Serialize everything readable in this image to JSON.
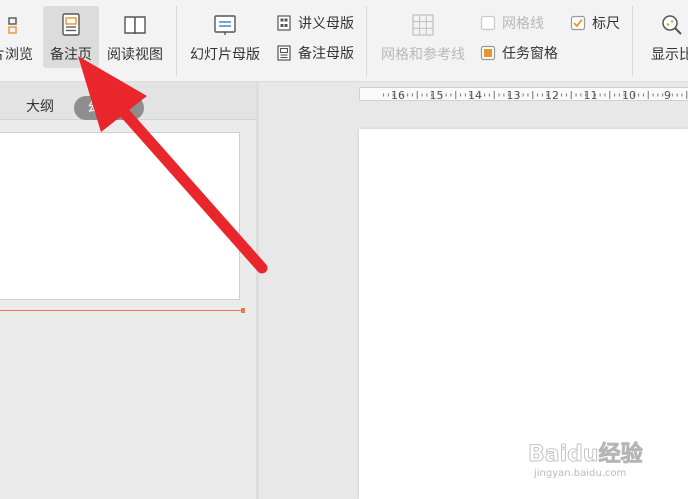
{
  "ribbon": {
    "browse_label": "片浏览",
    "notes_page_label": "备注页",
    "reading_view_label": "阅读视图",
    "slide_master_label": "幻灯片母版",
    "handout_master_label": "讲义母版",
    "notes_master_label": "备注母版",
    "grid_guides_label": "网格和参考线",
    "gridlines_label": "网格线",
    "ruler_label": "标尺",
    "task_pane_label": "任务窗格",
    "zoom_label": "显示比",
    "gridlines_checked": false,
    "ruler_checked": true,
    "task_pane_checked": true
  },
  "left_pane": {
    "tabs": [
      {
        "label": "大纲",
        "active": false
      },
      {
        "label": "幻灯片",
        "active": true
      }
    ]
  },
  "ruler": {
    "numbers": [
      "16",
      "15",
      "14",
      "13",
      "12",
      "11",
      "10",
      "9"
    ]
  },
  "watermark": {
    "text": "Baidu经验",
    "sub": "jingyan.baidu.com"
  },
  "colors": {
    "arrow": "#e8262b",
    "accent_orange": "#e87b4a",
    "ribbon_bg": "#f3f3f3",
    "active_button_bg": "#dcdcdc"
  }
}
